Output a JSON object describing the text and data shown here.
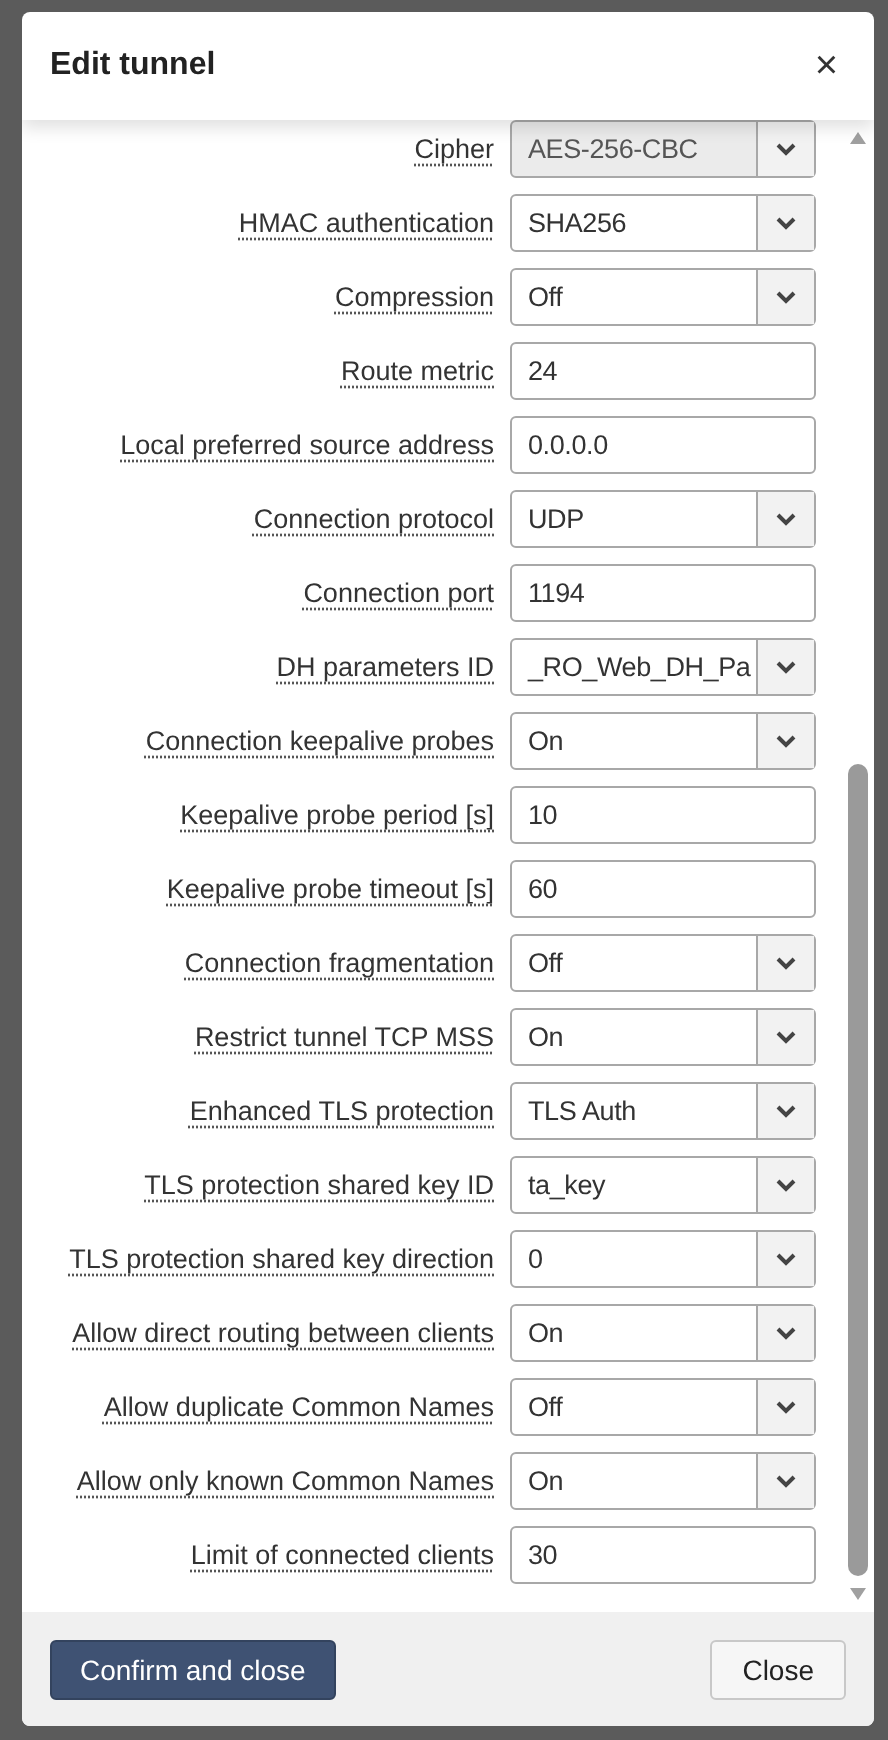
{
  "dialog": {
    "title": "Edit tunnel",
    "close": "×"
  },
  "fields": [
    {
      "label": "Cipher",
      "kind": "select",
      "value": "AES-256-CBC",
      "disabled": true
    },
    {
      "label": "HMAC authentication",
      "kind": "select",
      "value": "SHA256",
      "disabled": false
    },
    {
      "label": "Compression",
      "kind": "select",
      "value": "Off",
      "disabled": false
    },
    {
      "label": "Route metric",
      "kind": "text",
      "value": "24",
      "disabled": false
    },
    {
      "label": "Local preferred source address",
      "kind": "text",
      "value": "0.0.0.0",
      "disabled": false
    },
    {
      "label": "Connection protocol",
      "kind": "select",
      "value": "UDP",
      "disabled": false
    },
    {
      "label": "Connection port",
      "kind": "text",
      "value": "1194",
      "disabled": false
    },
    {
      "label": "DH parameters ID",
      "kind": "select",
      "value": "_RO_Web_DH_Pa",
      "disabled": false
    },
    {
      "label": "Connection keepalive probes",
      "kind": "select",
      "value": "On",
      "disabled": false
    },
    {
      "label": "Keepalive probe period [s]",
      "kind": "text",
      "value": "10",
      "disabled": false
    },
    {
      "label": "Keepalive probe timeout [s]",
      "kind": "text",
      "value": "60",
      "disabled": false
    },
    {
      "label": "Connection fragmentation",
      "kind": "select",
      "value": "Off",
      "disabled": false
    },
    {
      "label": "Restrict tunnel TCP MSS",
      "kind": "select",
      "value": "On",
      "disabled": false
    },
    {
      "label": "Enhanced TLS protection",
      "kind": "select",
      "value": "TLS Auth",
      "disabled": false
    },
    {
      "label": "TLS protection shared key ID",
      "kind": "select",
      "value": "ta_key",
      "disabled": false
    },
    {
      "label": "TLS protection shared key direction",
      "kind": "select",
      "value": "0",
      "disabled": false
    },
    {
      "label": "Allow direct routing between clients",
      "kind": "select",
      "value": "On",
      "disabled": false
    },
    {
      "label": "Allow duplicate Common Names",
      "kind": "select",
      "value": "Off",
      "disabled": false
    },
    {
      "label": "Allow only known Common Names",
      "kind": "select",
      "value": "On",
      "disabled": false
    },
    {
      "label": "Limit of connected clients",
      "kind": "text",
      "value": "30",
      "disabled": false
    }
  ],
  "buttons": [
    {
      "label": "Confirm and close",
      "kind": "primary"
    },
    {
      "label": "Close",
      "kind": "secondary"
    }
  ]
}
